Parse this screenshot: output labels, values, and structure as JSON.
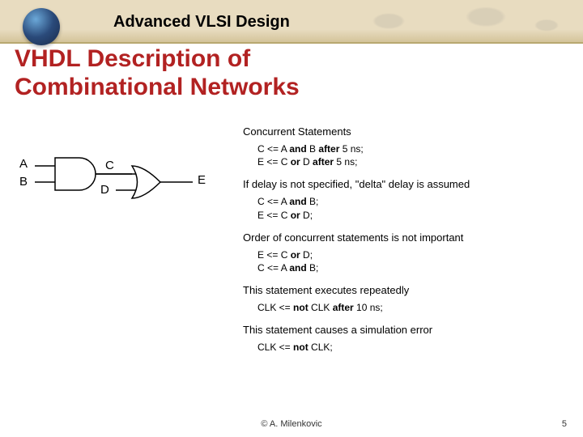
{
  "header": {
    "title": "Advanced VLSI Design"
  },
  "slide": {
    "title_line1": "VHDL Description of",
    "title_line2": "Combinational Networks"
  },
  "circuit": {
    "inputs": {
      "a": "A",
      "b": "B",
      "d": "D"
    },
    "mid": {
      "c": "C"
    },
    "output": {
      "e": "E"
    }
  },
  "sections": {
    "concurrent_label": "Concurrent Statements",
    "code1": {
      "l1_pre": "C <= A ",
      "l1_kw": "and",
      "l1_mid": " B   ",
      "l1_kw2": "after",
      "l1_post": " 5 ns;",
      "l2_pre": "E <= C ",
      "l2_kw": "or",
      "l2_mid": " D   ",
      "l2_kw2": "after",
      "l2_post": " 5 ns;"
    },
    "delta_label": "If delay is not specified, \"delta\" delay is assumed",
    "code2": {
      "l1_pre": "C <= A ",
      "l1_kw": "and",
      "l1_post": " B;",
      "l2_pre": "E <= C ",
      "l2_kw": "or",
      "l2_post": " D;"
    },
    "order_label": "Order of concurrent statements is not important",
    "code3": {
      "l1_pre": "E <= C ",
      "l1_kw": "or",
      "l1_post": " D;",
      "l2_pre": "C <= A ",
      "l2_kw": "and",
      "l2_post": " B;"
    },
    "repeat_label": "This statement executes repeatedly",
    "code4": {
      "l1_pre": "CLK <= ",
      "l1_kw": "not",
      "l1_mid": " CLK ",
      "l1_kw2": "after",
      "l1_post": " 10 ns;"
    },
    "error_label": "This statement causes a simulation error",
    "code5": {
      "l1_pre": "CLK <= ",
      "l1_kw": "not",
      "l1_post": " CLK;"
    }
  },
  "footer": {
    "copyright": "© A. Milenkovic",
    "page": "5"
  }
}
